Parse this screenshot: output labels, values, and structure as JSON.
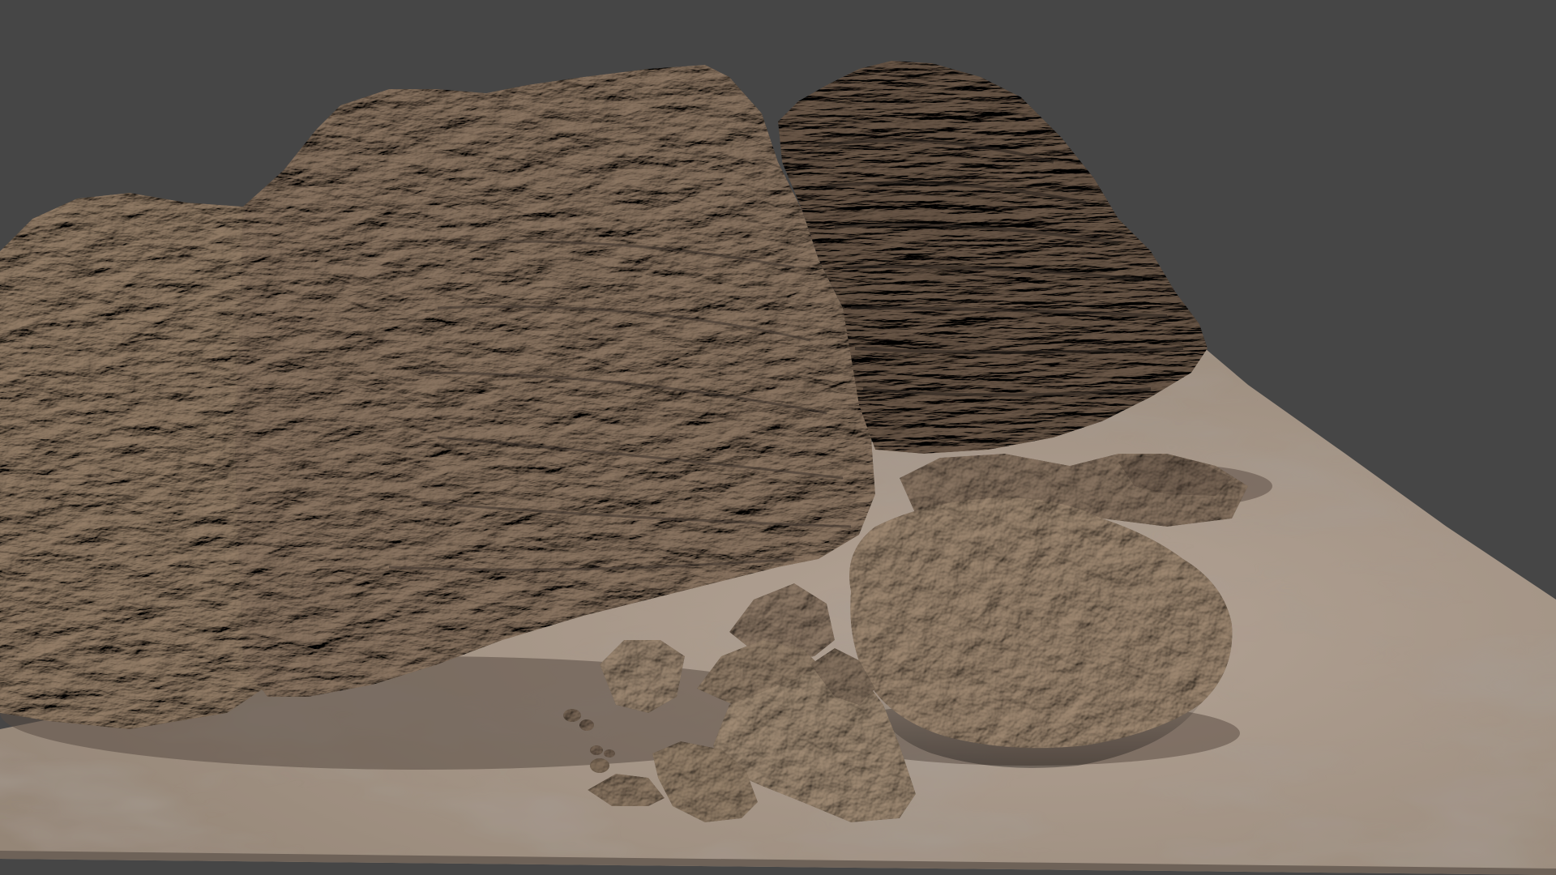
{
  "viewport": {
    "background_color": "#464646"
  },
  "materials": {
    "ground_color": "#a49486",
    "ground_shadow_color": "#7a6c62",
    "rock_light_color": "#8a7c70",
    "rock_mid_color": "#6b5e54",
    "rock_dark_color": "#3f3630",
    "rock_highlight_color": "#b7a796"
  },
  "scene_objects": [
    {
      "name": "ground-plane"
    },
    {
      "name": "cliff-left"
    },
    {
      "name": "cliff-main"
    },
    {
      "name": "cliff-layered-back"
    },
    {
      "name": "boulder-large"
    },
    {
      "name": "rock-chunks"
    },
    {
      "name": "pebbles"
    }
  ]
}
